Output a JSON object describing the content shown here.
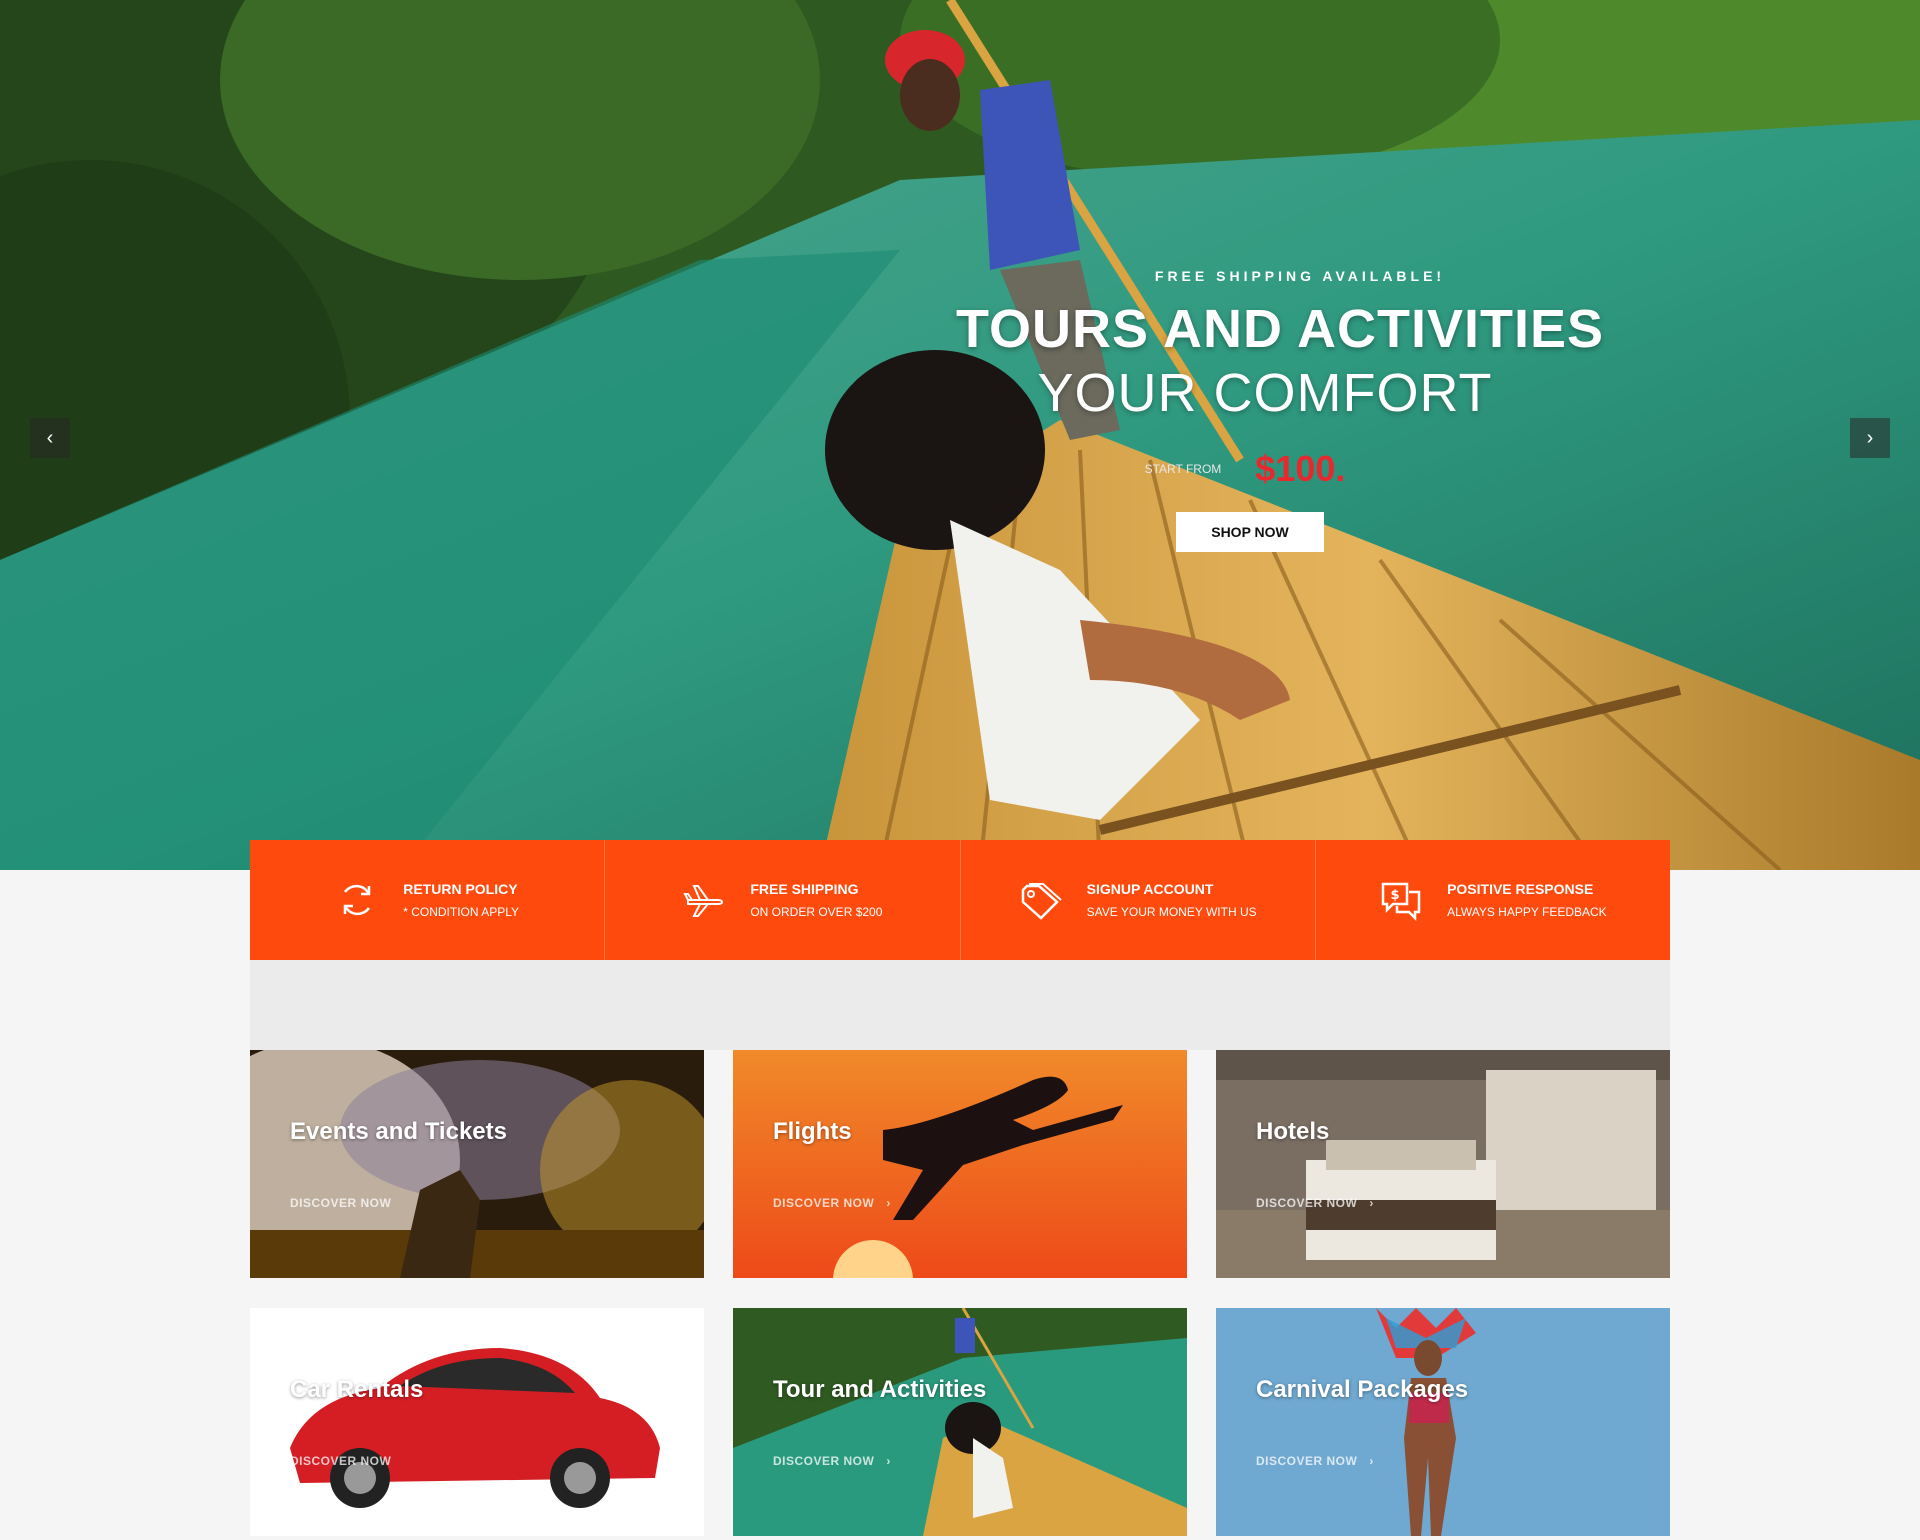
{
  "hero": {
    "eyebrow": "FREE SHIPPING AVAILABLE!",
    "title": "TOURS AND ACTIVITIES",
    "subtitle": "YOUR COMFORT",
    "start_label": "START FROM",
    "price": "$100.",
    "cta": "SHOP NOW",
    "prev_icon": "chevron-left-icon",
    "next_icon": "chevron-right-icon"
  },
  "features": [
    {
      "icon": "refresh-icon",
      "title": "RETURN POLICY",
      "sub": "* CONDITION APPLY"
    },
    {
      "icon": "airplane-icon",
      "title": "FREE SHIPPING",
      "sub": "ON ORDER OVER $200"
    },
    {
      "icon": "price-tag-icon",
      "title": "SIGNUP ACCOUNT",
      "sub": "SAVE YOUR MONEY WITH US"
    },
    {
      "icon": "chat-dollar-icon",
      "title": "POSITIVE RESPONSE",
      "sub": "ALWAYS HAPPY FEEDBACK"
    }
  ],
  "cards": [
    {
      "title": "Events and Tickets",
      "link": "DISCOVER NOW"
    },
    {
      "title": "Flights",
      "link": "DISCOVER NOW"
    },
    {
      "title": "Hotels",
      "link": "DISCOVER NOW"
    },
    {
      "title": "Car Rentals",
      "link": "DISCOVER NOW"
    },
    {
      "title": "Tour and Activities",
      "link": "DISCOVER NOW"
    },
    {
      "title": "Carnival Packages",
      "link": "DISCOVER NOW"
    }
  ],
  "colors": {
    "accent": "#ff4a0d",
    "price": "#e8282f",
    "carnival_bg": "#6fa8d0"
  }
}
